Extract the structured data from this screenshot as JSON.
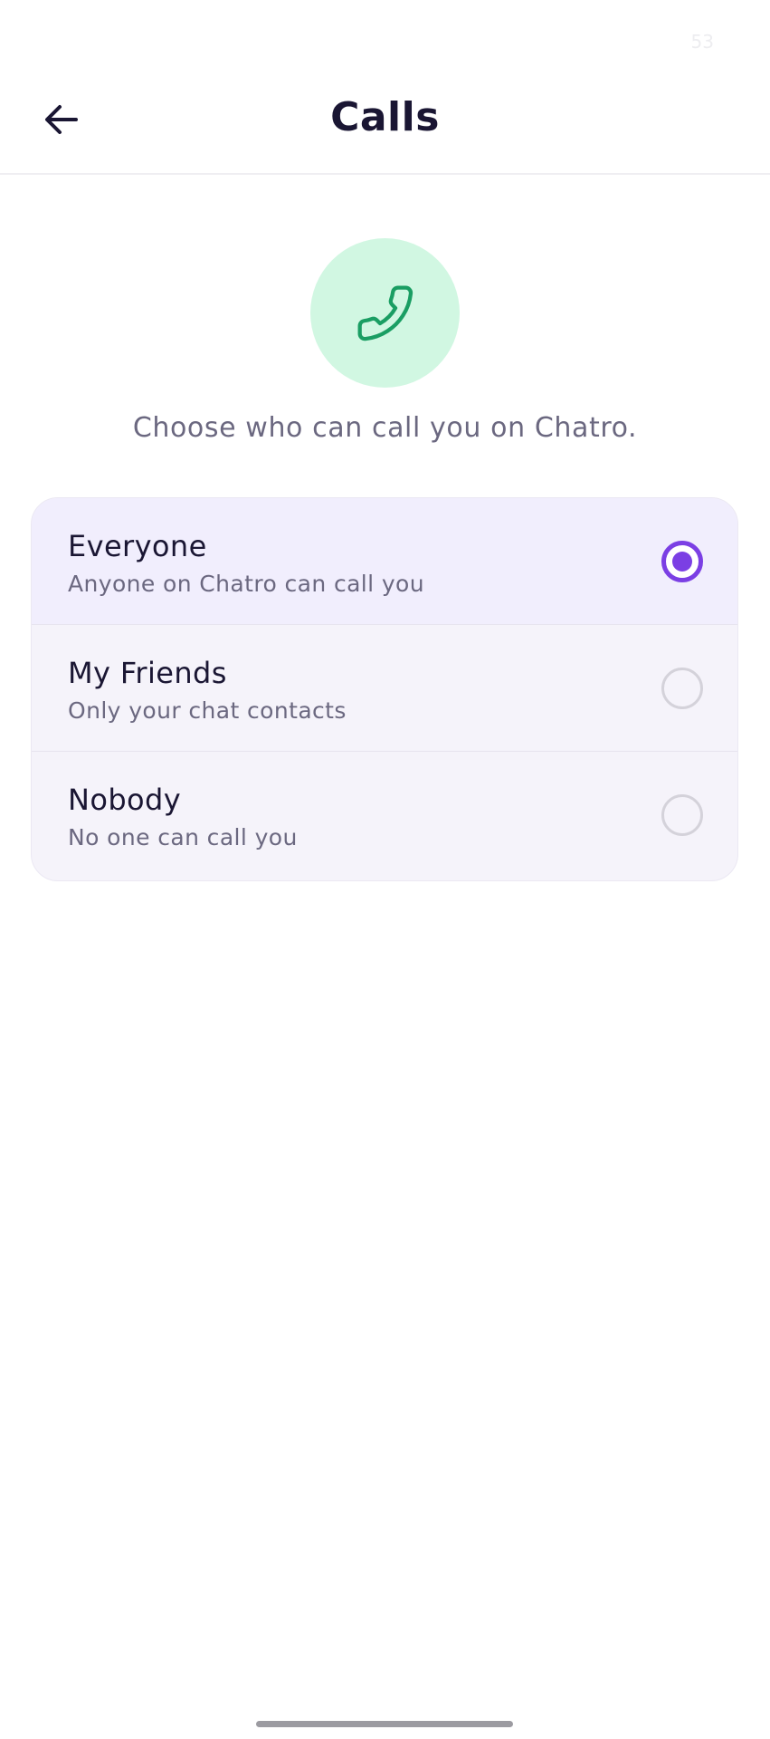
{
  "status_bar": {
    "time": "53"
  },
  "header": {
    "title": "Calls",
    "back_icon": "arrow-left-icon"
  },
  "hero": {
    "icon": "phone-icon",
    "icon_color": "#1a9e63",
    "circle_color": "#d1f7e2",
    "description": "Choose who can call you on Chatro."
  },
  "options": [
    {
      "title": "Everyone",
      "subtitle": "Anyone on Chatro can call you",
      "selected": true
    },
    {
      "title": "My Friends",
      "subtitle": "Only your chat contacts",
      "selected": false
    },
    {
      "title": "Nobody",
      "subtitle": "No one can call you",
      "selected": false
    }
  ],
  "colors": {
    "accent": "#7b3fe4",
    "title_text": "#1a1633",
    "secondary_text": "#6b6880",
    "card_bg": "#f5f3fa",
    "selected_bg": "#f1eefd"
  }
}
